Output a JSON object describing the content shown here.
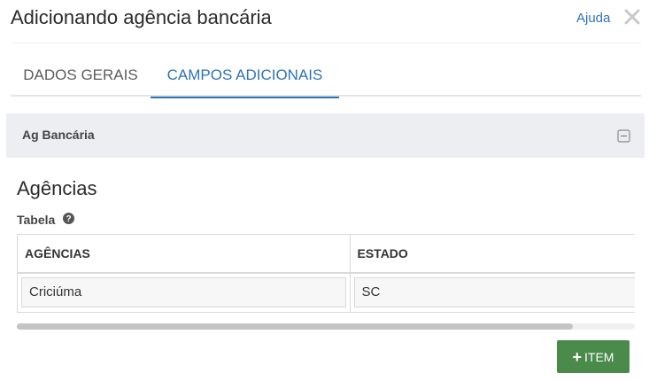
{
  "dialog": {
    "title": "Adicionando agência bancária",
    "help_label": "Ajuda",
    "close_icon": "close-icon"
  },
  "tabs": [
    {
      "label": "DADOS GERAIS",
      "active": false
    },
    {
      "label": "CAMPOS ADICIONAIS",
      "active": true
    }
  ],
  "section": {
    "title": "Ag Bancária",
    "collapse_icon": "minus-square-icon"
  },
  "block": {
    "title": "Agências",
    "field_label": "Tabela",
    "help_icon": "question-circle-icon"
  },
  "table": {
    "columns": [
      "AGÊNCIAS",
      "ESTADO"
    ],
    "rows": [
      [
        "Criciúma",
        "SC"
      ]
    ]
  },
  "actions": {
    "add_item_label": "ITEM",
    "add_item_icon": "plus-icon"
  },
  "colors": {
    "accent": "#2f73b6",
    "section_bg": "#eceef2",
    "button_bg": "#4a8a4a"
  }
}
